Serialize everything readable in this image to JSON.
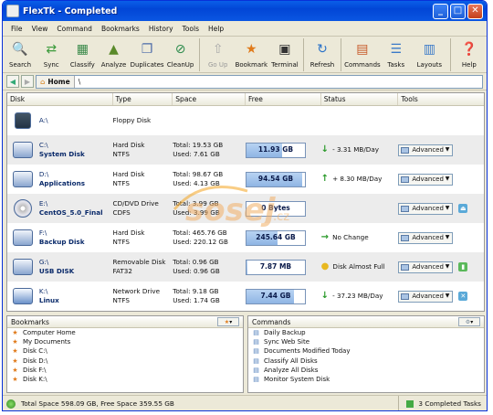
{
  "window": {
    "title": "FlexTk - Completed"
  },
  "menu": [
    "File",
    "View",
    "Command",
    "Bookmarks",
    "History",
    "Tools",
    "Help"
  ],
  "toolbar": [
    {
      "label": "Search",
      "icon": "search-icon"
    },
    {
      "label": "Sync",
      "icon": "sync-icon"
    },
    {
      "label": "Classify",
      "icon": "classify-icon"
    },
    {
      "label": "Analyze",
      "icon": "analyze-icon"
    },
    {
      "label": "Duplicates",
      "icon": "duplicates-icon"
    },
    {
      "label": "CleanUp",
      "icon": "cleanup-icon"
    },
    {
      "label": "Go Up",
      "icon": "go-up-icon"
    },
    {
      "label": "Bookmark",
      "icon": "bookmark-icon"
    },
    {
      "label": "Terminal",
      "icon": "terminal-icon"
    },
    {
      "label": "Refresh",
      "icon": "refresh-icon"
    },
    {
      "label": "Commands",
      "icon": "commands-icon"
    },
    {
      "label": "Tasks",
      "icon": "tasks-icon"
    },
    {
      "label": "Layouts",
      "icon": "layouts-icon"
    },
    {
      "label": "Help",
      "icon": "help-icon"
    }
  ],
  "address": {
    "home_label": "Home",
    "path": "\\"
  },
  "columns": [
    "Disk",
    "Type",
    "Space",
    "Free",
    "Status",
    "Tools"
  ],
  "disks": [
    {
      "letter": "A:\\",
      "name": "",
      "type1": "Floppy Disk",
      "type2": "",
      "total": "",
      "used": "",
      "free": "",
      "free_fraction": 0,
      "status": "",
      "status_icon": "",
      "advanced": "",
      "extra_icon": ""
    },
    {
      "letter": "C:\\",
      "name": "System Disk",
      "type1": "Hard Disk",
      "type2": "NTFS",
      "total": "Total: 19.53 GB",
      "used": "Used: 7.61 GB",
      "free": "11.93 GB",
      "free_fraction": 0.61,
      "status": "- 3.31 MB/Day",
      "status_icon": "down",
      "advanced": "Advanced",
      "extra_icon": ""
    },
    {
      "letter": "D:\\",
      "name": "Applications",
      "type1": "Hard Disk",
      "type2": "NTFS",
      "total": "Total: 98.67 GB",
      "used": "Used: 4.13 GB",
      "free": "94.54 GB",
      "free_fraction": 0.96,
      "status": "+ 8.30 MB/Day",
      "status_icon": "up",
      "advanced": "Advanced",
      "extra_icon": ""
    },
    {
      "letter": "E:\\",
      "name": "CentOS_5.0_Final",
      "type1": "CD/DVD Drive",
      "type2": "CDFS",
      "total": "Total: 3.99 GB",
      "used": "Used: 3.99 GB",
      "free": "0 Bytes",
      "free_fraction": 0,
      "status": "",
      "status_icon": "",
      "advanced": "Advanced",
      "extra_icon": "eject"
    },
    {
      "letter": "F:\\",
      "name": "Backup Disk",
      "type1": "Hard Disk",
      "type2": "NTFS",
      "total": "Total: 465.76 GB",
      "used": "Used: 220.12 GB",
      "free": "245.64 GB",
      "free_fraction": 0.53,
      "status": "No Change",
      "status_icon": "right",
      "advanced": "Advanced",
      "extra_icon": ""
    },
    {
      "letter": "G:\\",
      "name": "USB DISK",
      "type1": "Removable Disk",
      "type2": "FAT32",
      "total": "Total: 0.96 GB",
      "used": "Used: 0.96 GB",
      "free": "7.87 MB",
      "free_fraction": 0.01,
      "status": "Disk Almost Full",
      "status_icon": "warn",
      "advanced": "Advanced",
      "extra_icon": "usb"
    },
    {
      "letter": "K:\\",
      "name": "Linux",
      "type1": "Network Drive",
      "type2": "NTFS",
      "total": "Total: 9.18 GB",
      "used": "Used: 1.74 GB",
      "free": "7.44 GB",
      "free_fraction": 0.81,
      "status": "- 37.23 MB/Day",
      "status_icon": "down",
      "advanced": "Advanced",
      "extra_icon": "disconnect"
    }
  ],
  "bookmarks": {
    "title": "Bookmarks",
    "items": [
      "Computer Home",
      "My Documents",
      "Disk C:\\",
      "Disk D:\\",
      "Disk F:\\",
      "Disk K:\\"
    ]
  },
  "commands": {
    "title": "Commands",
    "items": [
      "Daily Backup",
      "Sync Web Site",
      "Documents Modified Today",
      "Classify All Disks",
      "Analyze All Disks",
      "Monitor System Disk"
    ]
  },
  "statusbar": {
    "left": "Total Space 598.09 GB, Free Space 359.55 GB",
    "right": "3 Completed Tasks"
  },
  "watermark": {
    "text": "sosej",
    "suffix": ".cz"
  }
}
